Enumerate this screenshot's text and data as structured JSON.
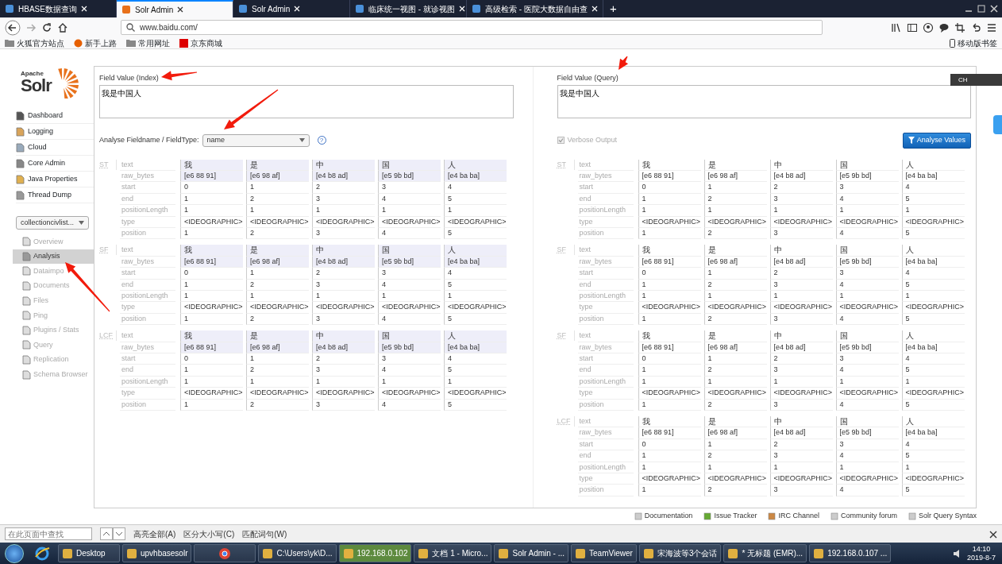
{
  "browser": {
    "tabs": [
      {
        "title": "HBASE数据查询",
        "selected": false
      },
      {
        "title": "Solr Admin",
        "selected": true
      },
      {
        "title": "Solr Admin",
        "selected": false
      },
      {
        "title": "临床统一视图 - 就诊视图",
        "selected": false
      },
      {
        "title": "高级检索 - 医院大数据自由查",
        "selected": false
      }
    ],
    "new_tab": "+",
    "address": "www.baidu.com/",
    "bookmarks": [
      "火狐官方站点",
      "新手上路",
      "常用网址",
      "京东商城"
    ],
    "mobile_bookmarks": "移动版书签"
  },
  "solr": {
    "logo": {
      "apache": "Apache",
      "name": "Solr"
    },
    "menu": [
      "Dashboard",
      "Logging",
      "Cloud",
      "Core Admin",
      "Java Properties",
      "Thread Dump"
    ],
    "core_selector": "collectioncivlist...",
    "core_menu": [
      {
        "label": "Overview",
        "selected": false
      },
      {
        "label": "Analysis",
        "selected": true
      },
      {
        "label": "Dataimpo",
        "selected": false
      },
      {
        "label": "Documents",
        "selected": false
      },
      {
        "label": "Files",
        "selected": false
      },
      {
        "label": "Ping",
        "selected": false
      },
      {
        "label": "Plugins / Stats",
        "selected": false
      },
      {
        "label": "Query",
        "selected": false
      },
      {
        "label": "Replication",
        "selected": false
      },
      {
        "label": "Schema Browser",
        "selected": false
      }
    ]
  },
  "analysis": {
    "index": {
      "label": "Field Value (Index)",
      "value": "我是中国人"
    },
    "query": {
      "label": "Field Value (Query)",
      "value": "我是中国人"
    },
    "fieldtype_label": "Analyse Fieldname / FieldType:",
    "fieldtype": "name",
    "help": "?",
    "verbose": {
      "label": "Verbose Output",
      "checked": true
    },
    "button": "Analyse Values",
    "index_stages": [
      {
        "abbr": "ST",
        "rows": [
          {
            "label": "text",
            "highlighted": true,
            "values": [
              "我",
              "是",
              "中",
              "国",
              "人"
            ]
          },
          {
            "label": "raw_bytes",
            "highlighted": true,
            "values": [
              "[e6 88 91]",
              "[e6 98 af]",
              "[e4 b8 ad]",
              "[e5 9b bd]",
              "[e4 ba ba]"
            ]
          },
          {
            "label": "start",
            "highlighted": false,
            "values": [
              "0",
              "1",
              "2",
              "3",
              "4"
            ]
          },
          {
            "label": "end",
            "highlighted": false,
            "values": [
              "1",
              "2",
              "3",
              "4",
              "5"
            ]
          },
          {
            "label": "positionLength",
            "highlighted": false,
            "values": [
              "1",
              "1",
              "1",
              "1",
              "1"
            ]
          },
          {
            "label": "type",
            "highlighted": false,
            "values": [
              "<IDEOGRAPHIC>",
              "<IDEOGRAPHIC>",
              "<IDEOGRAPHIC>",
              "<IDEOGRAPHIC>",
              "<IDEOGRAPHIC>"
            ]
          },
          {
            "label": "position",
            "highlighted": false,
            "values": [
              "1",
              "2",
              "3",
              "4",
              "5"
            ]
          }
        ]
      },
      {
        "abbr": "SF",
        "rows": [
          {
            "label": "text",
            "highlighted": true,
            "values": [
              "我",
              "是",
              "中",
              "国",
              "人"
            ]
          },
          {
            "label": "raw_bytes",
            "highlighted": true,
            "values": [
              "[e6 88 91]",
              "[e6 98 af]",
              "[e4 b8 ad]",
              "[e5 9b bd]",
              "[e4 ba ba]"
            ]
          },
          {
            "label": "start",
            "highlighted": false,
            "values": [
              "0",
              "1",
              "2",
              "3",
              "4"
            ]
          },
          {
            "label": "end",
            "highlighted": false,
            "values": [
              "1",
              "2",
              "3",
              "4",
              "5"
            ]
          },
          {
            "label": "positionLength",
            "highlighted": false,
            "values": [
              "1",
              "1",
              "1",
              "1",
              "1"
            ]
          },
          {
            "label": "type",
            "highlighted": false,
            "values": [
              "<IDEOGRAPHIC>",
              "<IDEOGRAPHIC>",
              "<IDEOGRAPHIC>",
              "<IDEOGRAPHIC>",
              "<IDEOGRAPHIC>"
            ]
          },
          {
            "label": "position",
            "highlighted": false,
            "values": [
              "1",
              "2",
              "3",
              "4",
              "5"
            ]
          }
        ]
      },
      {
        "abbr": "LCF",
        "rows": [
          {
            "label": "text",
            "highlighted": true,
            "values": [
              "我",
              "是",
              "中",
              "国",
              "人"
            ]
          },
          {
            "label": "raw_bytes",
            "highlighted": true,
            "values": [
              "[e6 88 91]",
              "[e6 98 af]",
              "[e4 b8 ad]",
              "[e5 9b bd]",
              "[e4 ba ba]"
            ]
          },
          {
            "label": "start",
            "highlighted": false,
            "values": [
              "0",
              "1",
              "2",
              "3",
              "4"
            ]
          },
          {
            "label": "end",
            "highlighted": false,
            "values": [
              "1",
              "2",
              "3",
              "4",
              "5"
            ]
          },
          {
            "label": "positionLength",
            "highlighted": false,
            "values": [
              "1",
              "1",
              "1",
              "1",
              "1"
            ]
          },
          {
            "label": "type",
            "highlighted": false,
            "values": [
              "<IDEOGRAPHIC>",
              "<IDEOGRAPHIC>",
              "<IDEOGRAPHIC>",
              "<IDEOGRAPHIC>",
              "<IDEOGRAPHIC>"
            ]
          },
          {
            "label": "position",
            "highlighted": false,
            "values": [
              "1",
              "2",
              "3",
              "4",
              "5"
            ]
          }
        ]
      }
    ],
    "query_stages": [
      {
        "abbr": "ST",
        "rows": [
          {
            "label": "text",
            "highlighted": false,
            "values": [
              "我",
              "是",
              "中",
              "国",
              "人"
            ]
          },
          {
            "label": "raw_bytes",
            "highlighted": false,
            "values": [
              "[e6 88 91]",
              "[e6 98 af]",
              "[e4 b8 ad]",
              "[e5 9b bd]",
              "[e4 ba ba]"
            ]
          },
          {
            "label": "start",
            "highlighted": false,
            "values": [
              "0",
              "1",
              "2",
              "3",
              "4"
            ]
          },
          {
            "label": "end",
            "highlighted": false,
            "values": [
              "1",
              "2",
              "3",
              "4",
              "5"
            ]
          },
          {
            "label": "positionLength",
            "highlighted": false,
            "values": [
              "1",
              "1",
              "1",
              "1",
              "1"
            ]
          },
          {
            "label": "type",
            "highlighted": false,
            "values": [
              "<IDEOGRAPHIC>",
              "<IDEOGRAPHIC>",
              "<IDEOGRAPHIC>",
              "<IDEOGRAPHIC>",
              "<IDEOGRAPHIC>"
            ]
          },
          {
            "label": "position",
            "highlighted": false,
            "values": [
              "1",
              "2",
              "3",
              "4",
              "5"
            ]
          }
        ]
      },
      {
        "abbr": "SF",
        "rows": [
          {
            "label": "text",
            "highlighted": false,
            "values": [
              "我",
              "是",
              "中",
              "国",
              "人"
            ]
          },
          {
            "label": "raw_bytes",
            "highlighted": false,
            "values": [
              "[e6 88 91]",
              "[e6 98 af]",
              "[e4 b8 ad]",
              "[e5 9b bd]",
              "[e4 ba ba]"
            ]
          },
          {
            "label": "start",
            "highlighted": false,
            "values": [
              "0",
              "1",
              "2",
              "3",
              "4"
            ]
          },
          {
            "label": "end",
            "highlighted": false,
            "values": [
              "1",
              "2",
              "3",
              "4",
              "5"
            ]
          },
          {
            "label": "positionLength",
            "highlighted": false,
            "values": [
              "1",
              "1",
              "1",
              "1",
              "1"
            ]
          },
          {
            "label": "type",
            "highlighted": false,
            "values": [
              "<IDEOGRAPHIC>",
              "<IDEOGRAPHIC>",
              "<IDEOGRAPHIC>",
              "<IDEOGRAPHIC>",
              "<IDEOGRAPHIC>"
            ]
          },
          {
            "label": "position",
            "highlighted": false,
            "values": [
              "1",
              "2",
              "3",
              "4",
              "5"
            ]
          }
        ]
      },
      {
        "abbr": "SF",
        "rows": [
          {
            "label": "text",
            "highlighted": false,
            "values": [
              "我",
              "是",
              "中",
              "国",
              "人"
            ]
          },
          {
            "label": "raw_bytes",
            "highlighted": false,
            "values": [
              "[e6 88 91]",
              "[e6 98 af]",
              "[e4 b8 ad]",
              "[e5 9b bd]",
              "[e4 ba ba]"
            ]
          },
          {
            "label": "start",
            "highlighted": false,
            "values": [
              "0",
              "1",
              "2",
              "3",
              "4"
            ]
          },
          {
            "label": "end",
            "highlighted": false,
            "values": [
              "1",
              "2",
              "3",
              "4",
              "5"
            ]
          },
          {
            "label": "positionLength",
            "highlighted": false,
            "values": [
              "1",
              "1",
              "1",
              "1",
              "1"
            ]
          },
          {
            "label": "type",
            "highlighted": false,
            "values": [
              "<IDEOGRAPHIC>",
              "<IDEOGRAPHIC>",
              "<IDEOGRAPHIC>",
              "<IDEOGRAPHIC>",
              "<IDEOGRAPHIC>"
            ]
          },
          {
            "label": "position",
            "highlighted": false,
            "values": [
              "1",
              "2",
              "3",
              "4",
              "5"
            ]
          }
        ]
      },
      {
        "abbr": "LCF",
        "rows": [
          {
            "label": "text",
            "highlighted": false,
            "values": [
              "我",
              "是",
              "中",
              "国",
              "人"
            ]
          },
          {
            "label": "raw_bytes",
            "highlighted": false,
            "values": [
              "[e6 88 91]",
              "[e6 98 af]",
              "[e4 b8 ad]",
              "[e5 9b bd]",
              "[e4 ba ba]"
            ]
          },
          {
            "label": "start",
            "highlighted": false,
            "values": [
              "0",
              "1",
              "2",
              "3",
              "4"
            ]
          },
          {
            "label": "end",
            "highlighted": false,
            "values": [
              "1",
              "2",
              "3",
              "4",
              "5"
            ]
          },
          {
            "label": "positionLength",
            "highlighted": false,
            "values": [
              "1",
              "1",
              "1",
              "1",
              "1"
            ]
          },
          {
            "label": "type",
            "highlighted": false,
            "values": [
              "<IDEOGRAPHIC>",
              "<IDEOGRAPHIC>",
              "<IDEOGRAPHIC>",
              "<IDEOGRAPHIC>",
              "<IDEOGRAPHIC>"
            ]
          },
          {
            "label": "position",
            "highlighted": false,
            "values": [
              "1",
              "2",
              "3",
              "4",
              "5"
            ]
          }
        ]
      }
    ]
  },
  "footer_links": [
    "Documentation",
    "Issue Tracker",
    "IRC Channel",
    "Community forum",
    "Solr Query Syntax"
  ],
  "ime_toolbar": {
    "label": "CH"
  },
  "find_bar": {
    "placeholder": "在此页面中查找",
    "options": [
      "高亮全部(A)",
      "区分大小写(C)",
      "匹配词句(W)"
    ]
  },
  "taskbar": {
    "items": [
      {
        "kind": "text",
        "label": "Desktop",
        "highlighted": false
      },
      {
        "kind": "text",
        "label": "upvhbasesolr",
        "highlighted": false
      },
      {
        "kind": "icon",
        "highlighted": false
      },
      {
        "kind": "text",
        "label": "C:\\Users\\yk\\D...",
        "highlighted": false
      },
      {
        "kind": "text",
        "label": "192.168.0.102",
        "highlighted": true
      },
      {
        "kind": "text",
        "label": "文档 1 - Micro...",
        "highlighted": false
      },
      {
        "kind": "text",
        "label": "Solr Admin - ...",
        "highlighted": false
      },
      {
        "kind": "text",
        "label": "TeamViewer",
        "highlighted": false
      },
      {
        "kind": "text",
        "label": "宋海波等3个会话",
        "highlighted": false
      },
      {
        "kind": "text",
        "label": "* 无标题 (EMR)...",
        "highlighted": false
      },
      {
        "kind": "text",
        "label": "192.168.0.107 ...",
        "highlighted": false
      }
    ],
    "time": "14:10",
    "date": "2019-8-7"
  }
}
